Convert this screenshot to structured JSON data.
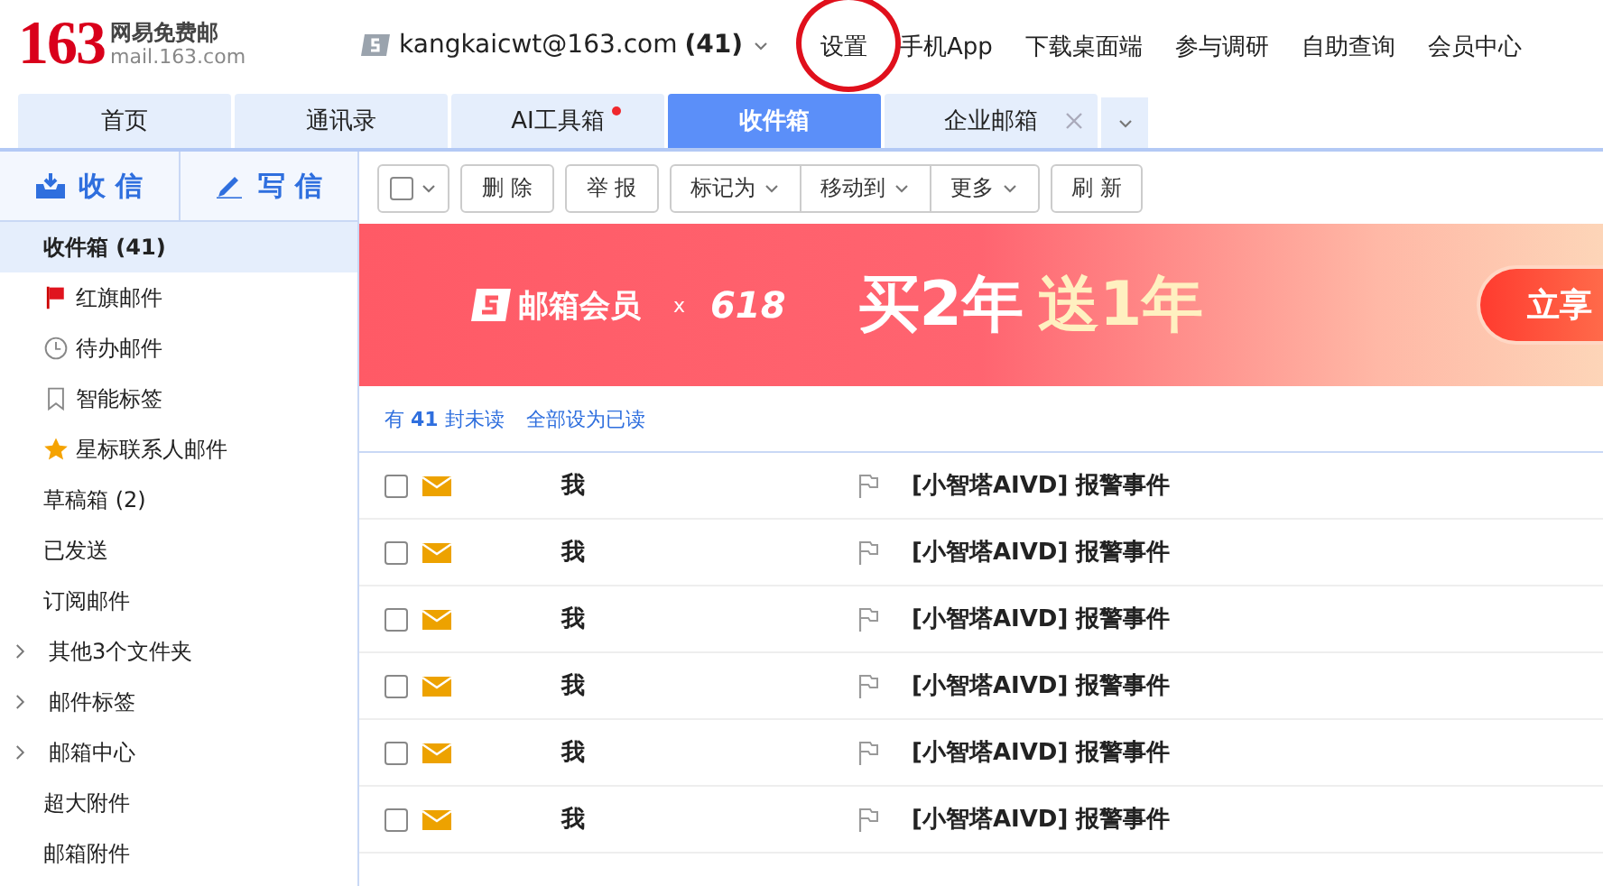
{
  "logo": {
    "number": "163",
    "name": "网易免费邮",
    "domain": "mail.163.com"
  },
  "account": {
    "email": "kangkaicwt@163.com",
    "count": "(41)"
  },
  "nav_links": [
    {
      "label": "设置",
      "circled": true
    },
    {
      "label": "手机App",
      "circled": false
    },
    {
      "label": "下载桌面端",
      "circled": false
    },
    {
      "label": "参与调研",
      "circled": false
    },
    {
      "label": "自助查询",
      "circled": false
    },
    {
      "label": "会员中心",
      "circled": false
    }
  ],
  "tabs": [
    {
      "label": "首页",
      "selected": false,
      "badge": false,
      "closable": false
    },
    {
      "label": "通讯录",
      "selected": false,
      "badge": false,
      "closable": false
    },
    {
      "label": "AI工具箱",
      "selected": false,
      "badge": true,
      "closable": false
    },
    {
      "label": "收件箱",
      "selected": true,
      "badge": false,
      "closable": false
    },
    {
      "label": "企业邮箱",
      "selected": false,
      "badge": false,
      "closable": true
    }
  ],
  "actions": [
    {
      "kind": "receive",
      "label": "收 信"
    },
    {
      "kind": "compose",
      "label": "写 信"
    }
  ],
  "sidebar": {
    "items": [
      {
        "kind": "plain",
        "label": "收件箱 (41)",
        "selected": true
      },
      {
        "kind": "flag",
        "label": "红旗邮件",
        "selected": false
      },
      {
        "kind": "clock",
        "label": "待办邮件",
        "selected": false
      },
      {
        "kind": "bookmark",
        "label": "智能标签",
        "selected": false
      },
      {
        "kind": "star",
        "label": "星标联系人邮件",
        "selected": false
      },
      {
        "kind": "plain",
        "label": "草稿箱 (2)",
        "selected": false
      },
      {
        "kind": "plain",
        "label": "已发送",
        "selected": false
      },
      {
        "kind": "plain",
        "label": "订阅邮件",
        "selected": false
      },
      {
        "kind": "expandable",
        "label": "其他3个文件夹",
        "selected": false
      },
      {
        "kind": "expandable",
        "label": "邮件标签",
        "selected": false
      },
      {
        "kind": "expandable",
        "label": "邮箱中心",
        "selected": false
      },
      {
        "kind": "plain",
        "label": "超大附件",
        "selected": false
      },
      {
        "kind": "plain",
        "label": "邮箱附件",
        "selected": false
      }
    ]
  },
  "toolbar": {
    "select_all": {
      "checked": false
    },
    "buttons": [
      {
        "label": "删 除",
        "dropdown": false,
        "group": false
      },
      {
        "label": "举 报",
        "dropdown": false,
        "group": false
      },
      {
        "label": "标记为",
        "dropdown": true,
        "group": true
      },
      {
        "label": "移动到",
        "dropdown": true,
        "group": true
      },
      {
        "label": "更多",
        "dropdown": true,
        "group": true
      },
      {
        "label": "刷 新",
        "dropdown": false,
        "group": false
      }
    ]
  },
  "banner": {
    "brand": "邮箱会员",
    "times": "x",
    "event": "618",
    "offer": "买2年",
    "bonus": "送1年",
    "cta": "立享"
  },
  "unread_bar": {
    "prefix": "有",
    "count": "41",
    "suffix": "封未读",
    "action": "全部设为已读"
  },
  "messages": [
    {
      "checked": false,
      "unread": true,
      "sender": "我",
      "flagged": false,
      "subject": "[小智塔AIVD] 报警事件"
    },
    {
      "checked": false,
      "unread": true,
      "sender": "我",
      "flagged": false,
      "subject": "[小智塔AIVD] 报警事件"
    },
    {
      "checked": false,
      "unread": true,
      "sender": "我",
      "flagged": false,
      "subject": "[小智塔AIVD] 报警事件"
    },
    {
      "checked": false,
      "unread": true,
      "sender": "我",
      "flagged": false,
      "subject": "[小智塔AIVD] 报警事件"
    },
    {
      "checked": false,
      "unread": true,
      "sender": "我",
      "flagged": false,
      "subject": "[小智塔AIVD] 报警事件"
    },
    {
      "checked": false,
      "unread": true,
      "sender": "我",
      "flagged": false,
      "subject": "[小智塔AIVD] 报警事件"
    }
  ]
}
